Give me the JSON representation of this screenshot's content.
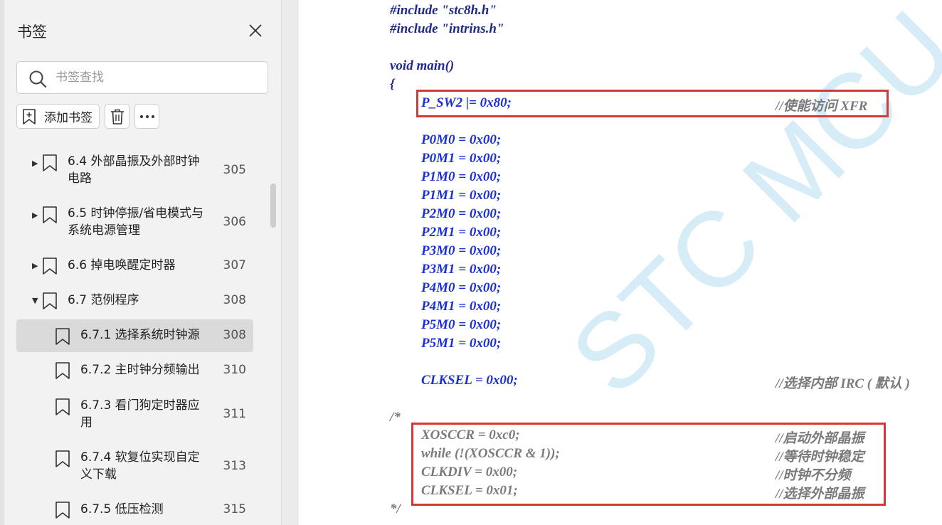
{
  "sidebar": {
    "title": "书签",
    "search_placeholder": "书签查找",
    "add_bookmark_label": "添加书签",
    "items": [
      {
        "label_lines": [
          "6.4  外部晶振及外部时钟",
          "电路"
        ],
        "page": "305",
        "expandable": true,
        "expanded": false
      },
      {
        "label_lines": [
          "6.5  时钟停振/省电模式与",
          "系统电源管理"
        ],
        "page": "306",
        "expandable": true,
        "expanded": false
      },
      {
        "label_lines": [
          "6.6  掉电唤醒定时器"
        ],
        "page": "307",
        "expandable": true,
        "expanded": false
      },
      {
        "label_lines": [
          "6.7  范例程序"
        ],
        "page": "308",
        "expandable": true,
        "expanded": true
      },
      {
        "label_lines": [
          "6.7.1 选择系统时钟源"
        ],
        "page": "308",
        "selected": true
      },
      {
        "label_lines": [
          "6.7.2 主时钟分频输出"
        ],
        "page": "310"
      },
      {
        "label_lines": [
          "6.7.3 看门狗定时器应",
          "用"
        ],
        "page": "311"
      },
      {
        "label_lines": [
          "6.7.4 软复位实现自定",
          "义下载"
        ],
        "page": "313"
      },
      {
        "label_lines": [
          "6.7.5 低压检测"
        ],
        "page": "315"
      }
    ]
  },
  "document": {
    "watermark": "STC MCU",
    "includes": [
      "#include \"stc8h.h\"",
      "#include \"intrins.h\""
    ],
    "main_sig": "void main()",
    "open_brace": "{",
    "psw2_stmt": "P_SW2 |= 0x80;",
    "psw2_comment": "//使能访问 XFR",
    "port_stmts": [
      "P0M0 = 0x00;",
      "P0M1 = 0x00;",
      "P1M0 = 0x00;",
      "P1M1 = 0x00;",
      "P2M0 = 0x00;",
      "P2M1 = 0x00;",
      "P3M0 = 0x00;",
      "P3M1 = 0x00;",
      "P4M0 = 0x00;",
      "P4M1 = 0x00;",
      "P5M0 = 0x00;",
      "P5M1 = 0x00;"
    ],
    "clksel_stmt": "CLKSEL = 0x00;",
    "clksel_comment": "//选择内部 IRC ( 默认 )",
    "comment_open": "/*",
    "comment_close": "*/",
    "commented_block": [
      {
        "code": "XOSCCR = 0xc0;",
        "comment": "//启动外部晶振"
      },
      {
        "code": "while (!(XOSCCR & 1));",
        "comment": "//等待时钟稳定"
      },
      {
        "code": "CLKDIV = 0x00;",
        "comment": "//时钟不分频"
      },
      {
        "code": "CLKSEL = 0x01;",
        "comment": "//选择外部晶振"
      }
    ]
  }
}
